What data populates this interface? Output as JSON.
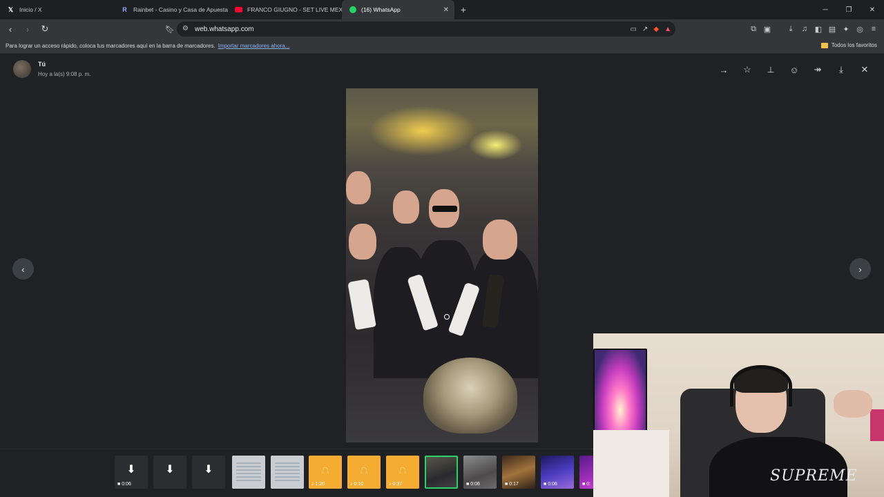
{
  "browser": {
    "tabs": [
      {
        "label": "Inicio / X",
        "icon": "x-logo-icon"
      },
      {
        "label": "Rainbet - Casino y Casa de Apuestas",
        "icon": "rainbet-icon"
      },
      {
        "label": "FRANCO GIUGNO - SET LIVE MEXICO",
        "icon": "youtube-icon"
      },
      {
        "label": "(16) WhatsApp",
        "icon": "whatsapp-icon",
        "active": true
      }
    ],
    "url": "web.whatsapp.com",
    "bookmarks_prompt": "Para lograr un acceso rápido, coloca tus marcadores aquí en la barra de marcadores.",
    "bookmarks_import": "Importar marcadores ahora...",
    "favorites_folder": "Todos los favoritos"
  },
  "viewer": {
    "sender_name": "Tú",
    "sender_time": "Hoy a la(s) 9:08 p. m.",
    "actions": [
      "go-to-message-icon",
      "star-icon",
      "pin-icon",
      "emoji-icon",
      "forward-icon",
      "download-icon",
      "close-icon"
    ],
    "thumbnails": [
      {
        "kind": "download",
        "duration": "0:06"
      },
      {
        "kind": "download",
        "duration": ""
      },
      {
        "kind": "download",
        "duration": ""
      },
      {
        "kind": "document",
        "duration": ""
      },
      {
        "kind": "document",
        "duration": ""
      },
      {
        "kind": "audio",
        "duration": "1:20"
      },
      {
        "kind": "audio",
        "duration": "0:10"
      },
      {
        "kind": "audio",
        "duration": "0:37"
      },
      {
        "kind": "photo",
        "duration": "",
        "selected": true
      },
      {
        "kind": "video",
        "duration": "0:06"
      },
      {
        "kind": "video",
        "duration": "0:17"
      },
      {
        "kind": "video",
        "duration": "0:06"
      },
      {
        "kind": "video",
        "duration": "0:"
      }
    ]
  },
  "colors": {
    "accent": "#25d366",
    "audio_thumb": "#f4ac33",
    "viewer_bg": "#1f2124"
  },
  "webcam": {
    "shirt_logo": "SUPREME"
  }
}
